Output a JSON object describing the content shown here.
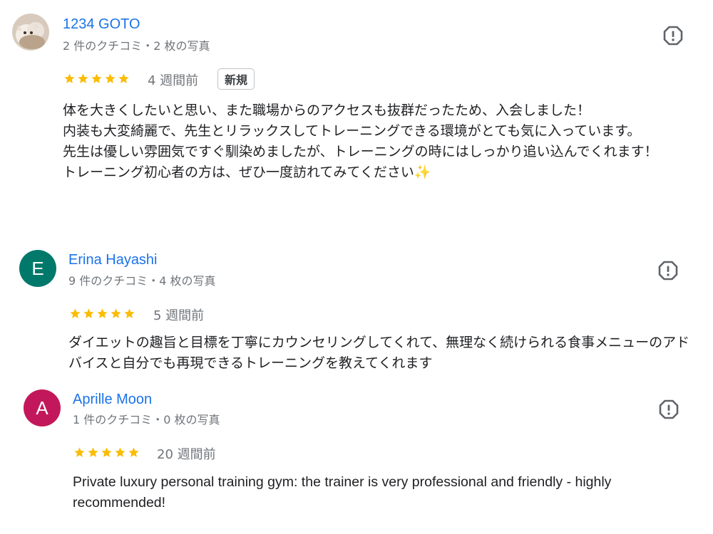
{
  "reviews": [
    {
      "author": "1234 GOTO",
      "meta": "2 件のクチコミ・2 枚の写真",
      "avatar": {
        "type": "photo",
        "icon": "cat-photo-avatar"
      },
      "rating": 5,
      "time": "4 週間前",
      "badge": "新規",
      "body": "体を大きくしたいと思い、また職場からのアクセスも抜群だったため、入会しました！\n内装も大変綺麗で、先生とリラックスしてトレーニングできる環境がとても気に入っています。\n先生は優しい雰囲気ですぐ馴染めましたが、トレーニングの時にはしっかり追い込んでくれます！\nトレーニング初心者の方は、ぜひ一度訪れてみてください✨"
    },
    {
      "author": "Erina Hayashi",
      "meta": "9 件のクチコミ・4 枚の写真",
      "avatar": {
        "type": "letter",
        "letter": "E",
        "color": "#00796b"
      },
      "rating": 5,
      "time": "5 週間前",
      "body": "ダイエットの趣旨と目標を丁寧にカウンセリングしてくれて、無理なく続けられる食事メニューのアドバイスと自分でも再現できるトレーニングを教えてくれます"
    },
    {
      "author": "Aprille Moon",
      "meta": "1 件のクチコミ・0 枚の写真",
      "avatar": {
        "type": "letter",
        "letter": "A",
        "color": "#c2185b"
      },
      "rating": 5,
      "time": "20 週間前",
      "body": "Private luxury personal training gym: the trainer is very professional and friendly - highly recommended!"
    }
  ],
  "icons": {
    "star": "star-icon",
    "report": "report-flag-icon"
  },
  "colors": {
    "author_link": "#1a73e8",
    "star": "#fbbc04",
    "meta": "#70757a",
    "report_icon": "#5f6368"
  }
}
